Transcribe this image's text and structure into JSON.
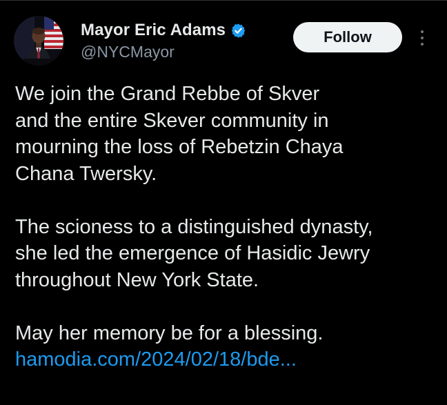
{
  "author": {
    "display_name": "Mayor Eric Adams",
    "handle": "@NYCMayor",
    "verified_icon": "verified-badge-icon",
    "avatar_icon": "profile-avatar"
  },
  "actions": {
    "follow_label": "Follow",
    "more_icon": "more-options-icon"
  },
  "post": {
    "paragraphs": [
      {
        "lines": [
          "We join the Grand Rebbe of Skver",
          "and the entire Skever community in",
          "mourning the loss of Rebetzin Chaya",
          "Chana Twersky."
        ]
      },
      {
        "lines": [
          "The scioness to a distinguished dynasty,",
          "she led the emergence of Hasidic Jewry",
          "throughout New York State."
        ]
      },
      {
        "lines": [
          "May her memory be for a blessing."
        ]
      }
    ],
    "link_text": "hamodia.com/2024/02/18/bde..."
  },
  "colors": {
    "background": "#000000",
    "text_primary": "#e7e9ea",
    "text_secondary": "#8b98a5",
    "link": "#1d9bf0",
    "verified": "#1d9bf0",
    "follow_bg": "#eff3f4",
    "follow_text": "#0f1419"
  }
}
